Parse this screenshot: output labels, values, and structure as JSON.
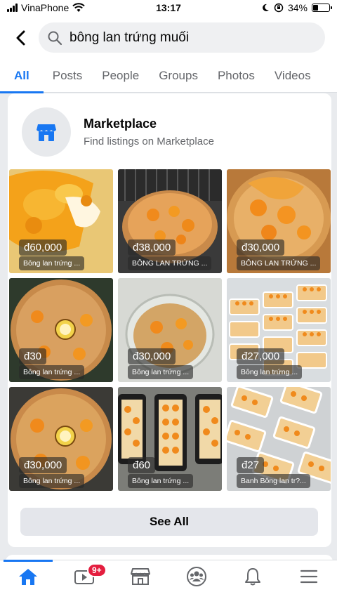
{
  "status_bar": {
    "carrier": "VinaPhone",
    "time": "13:17",
    "battery": "34%",
    "battery_level": 0.34
  },
  "search": {
    "query": "bông lan trứng muối",
    "icons": [
      "chevron-left-icon",
      "search-icon"
    ]
  },
  "tabs": [
    {
      "label": "All",
      "active": true
    },
    {
      "label": "Posts"
    },
    {
      "label": "People"
    },
    {
      "label": "Groups"
    },
    {
      "label": "Photos"
    },
    {
      "label": "Videos"
    }
  ],
  "marketplace": {
    "title": "Marketplace",
    "subtitle": "Find listings on Marketplace",
    "listings": [
      {
        "price": "đ60,000",
        "title": "Bông lan trứng ..."
      },
      {
        "price": "đ38,000",
        "title": "BÔNG LAN TRỨNG ..."
      },
      {
        "price": "đ30,000",
        "title": "BÔNG LAN TRỨNG ..."
      },
      {
        "price": "đ30",
        "title": "Bông lan trứng ..."
      },
      {
        "price": "đ30,000",
        "title": "Bông lan trứng ..."
      },
      {
        "price": "đ27,000",
        "title": "Bông lan trứng ..."
      },
      {
        "price": "đ30,000",
        "title": "Bông lan trứng ..."
      },
      {
        "price": "đ60",
        "title": "Bông lan trứng ..."
      },
      {
        "price": "đ27",
        "title": "Banh Bông lan tr?..."
      }
    ],
    "see_all": "See All"
  },
  "bottom_nav": {
    "items": [
      "home-icon",
      "watch-icon",
      "marketplace-icon",
      "groups-icon",
      "notifications-icon",
      "menu-icon"
    ],
    "watch_badge": "9+"
  },
  "colors": {
    "accent": "#1877f2",
    "badge": "#e41e3f",
    "background": "#e9ebee"
  }
}
